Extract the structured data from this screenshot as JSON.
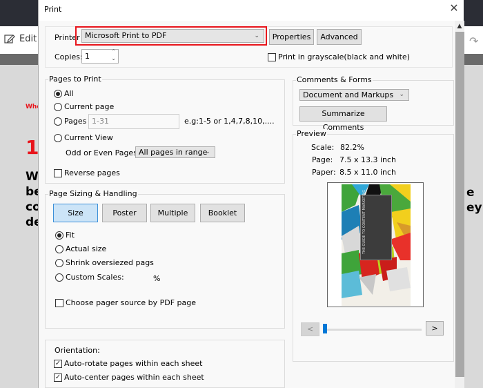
{
  "background": {
    "toolbar_edit_label": "Edit",
    "doc_red_small": "Whe",
    "doc_red_big": "1",
    "doc_lines": [
      "Wh",
      "be",
      "co",
      "de"
    ],
    "doc_right_lines": [
      "e",
      "ey"
    ]
  },
  "dialog": {
    "title": "Print",
    "printer": {
      "label": "Printer",
      "selected": "Microsoft Print to PDF",
      "properties_label": "Properties",
      "advanced_label": "Advanced"
    },
    "copies": {
      "label": "Copies:",
      "value": "1"
    },
    "grayscale": {
      "label": "Print in grayscale(black and white)",
      "checked": false
    },
    "pages_to_print": {
      "title": "Pages to Print",
      "options": [
        "All",
        "Current page",
        "Pages",
        "Current View"
      ],
      "selected": "All",
      "pages_value": "1-31",
      "pages_hint": "e.g:1-5 or 1,4,7,8,10,....",
      "odd_even_label": "Odd or Even Pages:",
      "odd_even_selected": "All pages in range",
      "reverse_label": "Reverse pages",
      "reverse_checked": false
    },
    "page_sizing": {
      "title": "Page Sizing & Handling",
      "tabs": [
        "Size",
        "Poster",
        "Multiple",
        "Booklet"
      ],
      "active_tab": "Size",
      "options": [
        "Fit",
        "Actual size",
        "Shrink oversiezed pags",
        "Custom Scales:"
      ],
      "selected": "Fit",
      "percent_sign": "%",
      "paper_source_label": "Choose pager source by PDF page",
      "paper_source_checked": false
    },
    "orientation": {
      "title": "Orientation:",
      "auto_rotate_label": "Auto-rotate pages within each sheet",
      "auto_rotate_checked": true,
      "auto_center_label": "Auto-center pages within each sheet",
      "auto_center_checked": true
    },
    "comments_forms": {
      "title": "Comments & Forms",
      "selected": "Document and Markups",
      "summarize_label": "Summarize Comments"
    },
    "preview": {
      "title": "Preview",
      "scale_label": "Scale:",
      "scale_value": "82.2%",
      "page_label": "Page:",
      "page_value": "7.5 x 13.3 inch",
      "paper_label": "Paper:",
      "paper_value": "8.5 x 11.0 inch",
      "cover_text": "THE GUIDE TO CONTENT MARKETING",
      "prev_label": "<",
      "next_label": ">",
      "slider_position": 0.0
    },
    "accent_color": "#0078d7",
    "highlight_color": "#e8141b"
  }
}
